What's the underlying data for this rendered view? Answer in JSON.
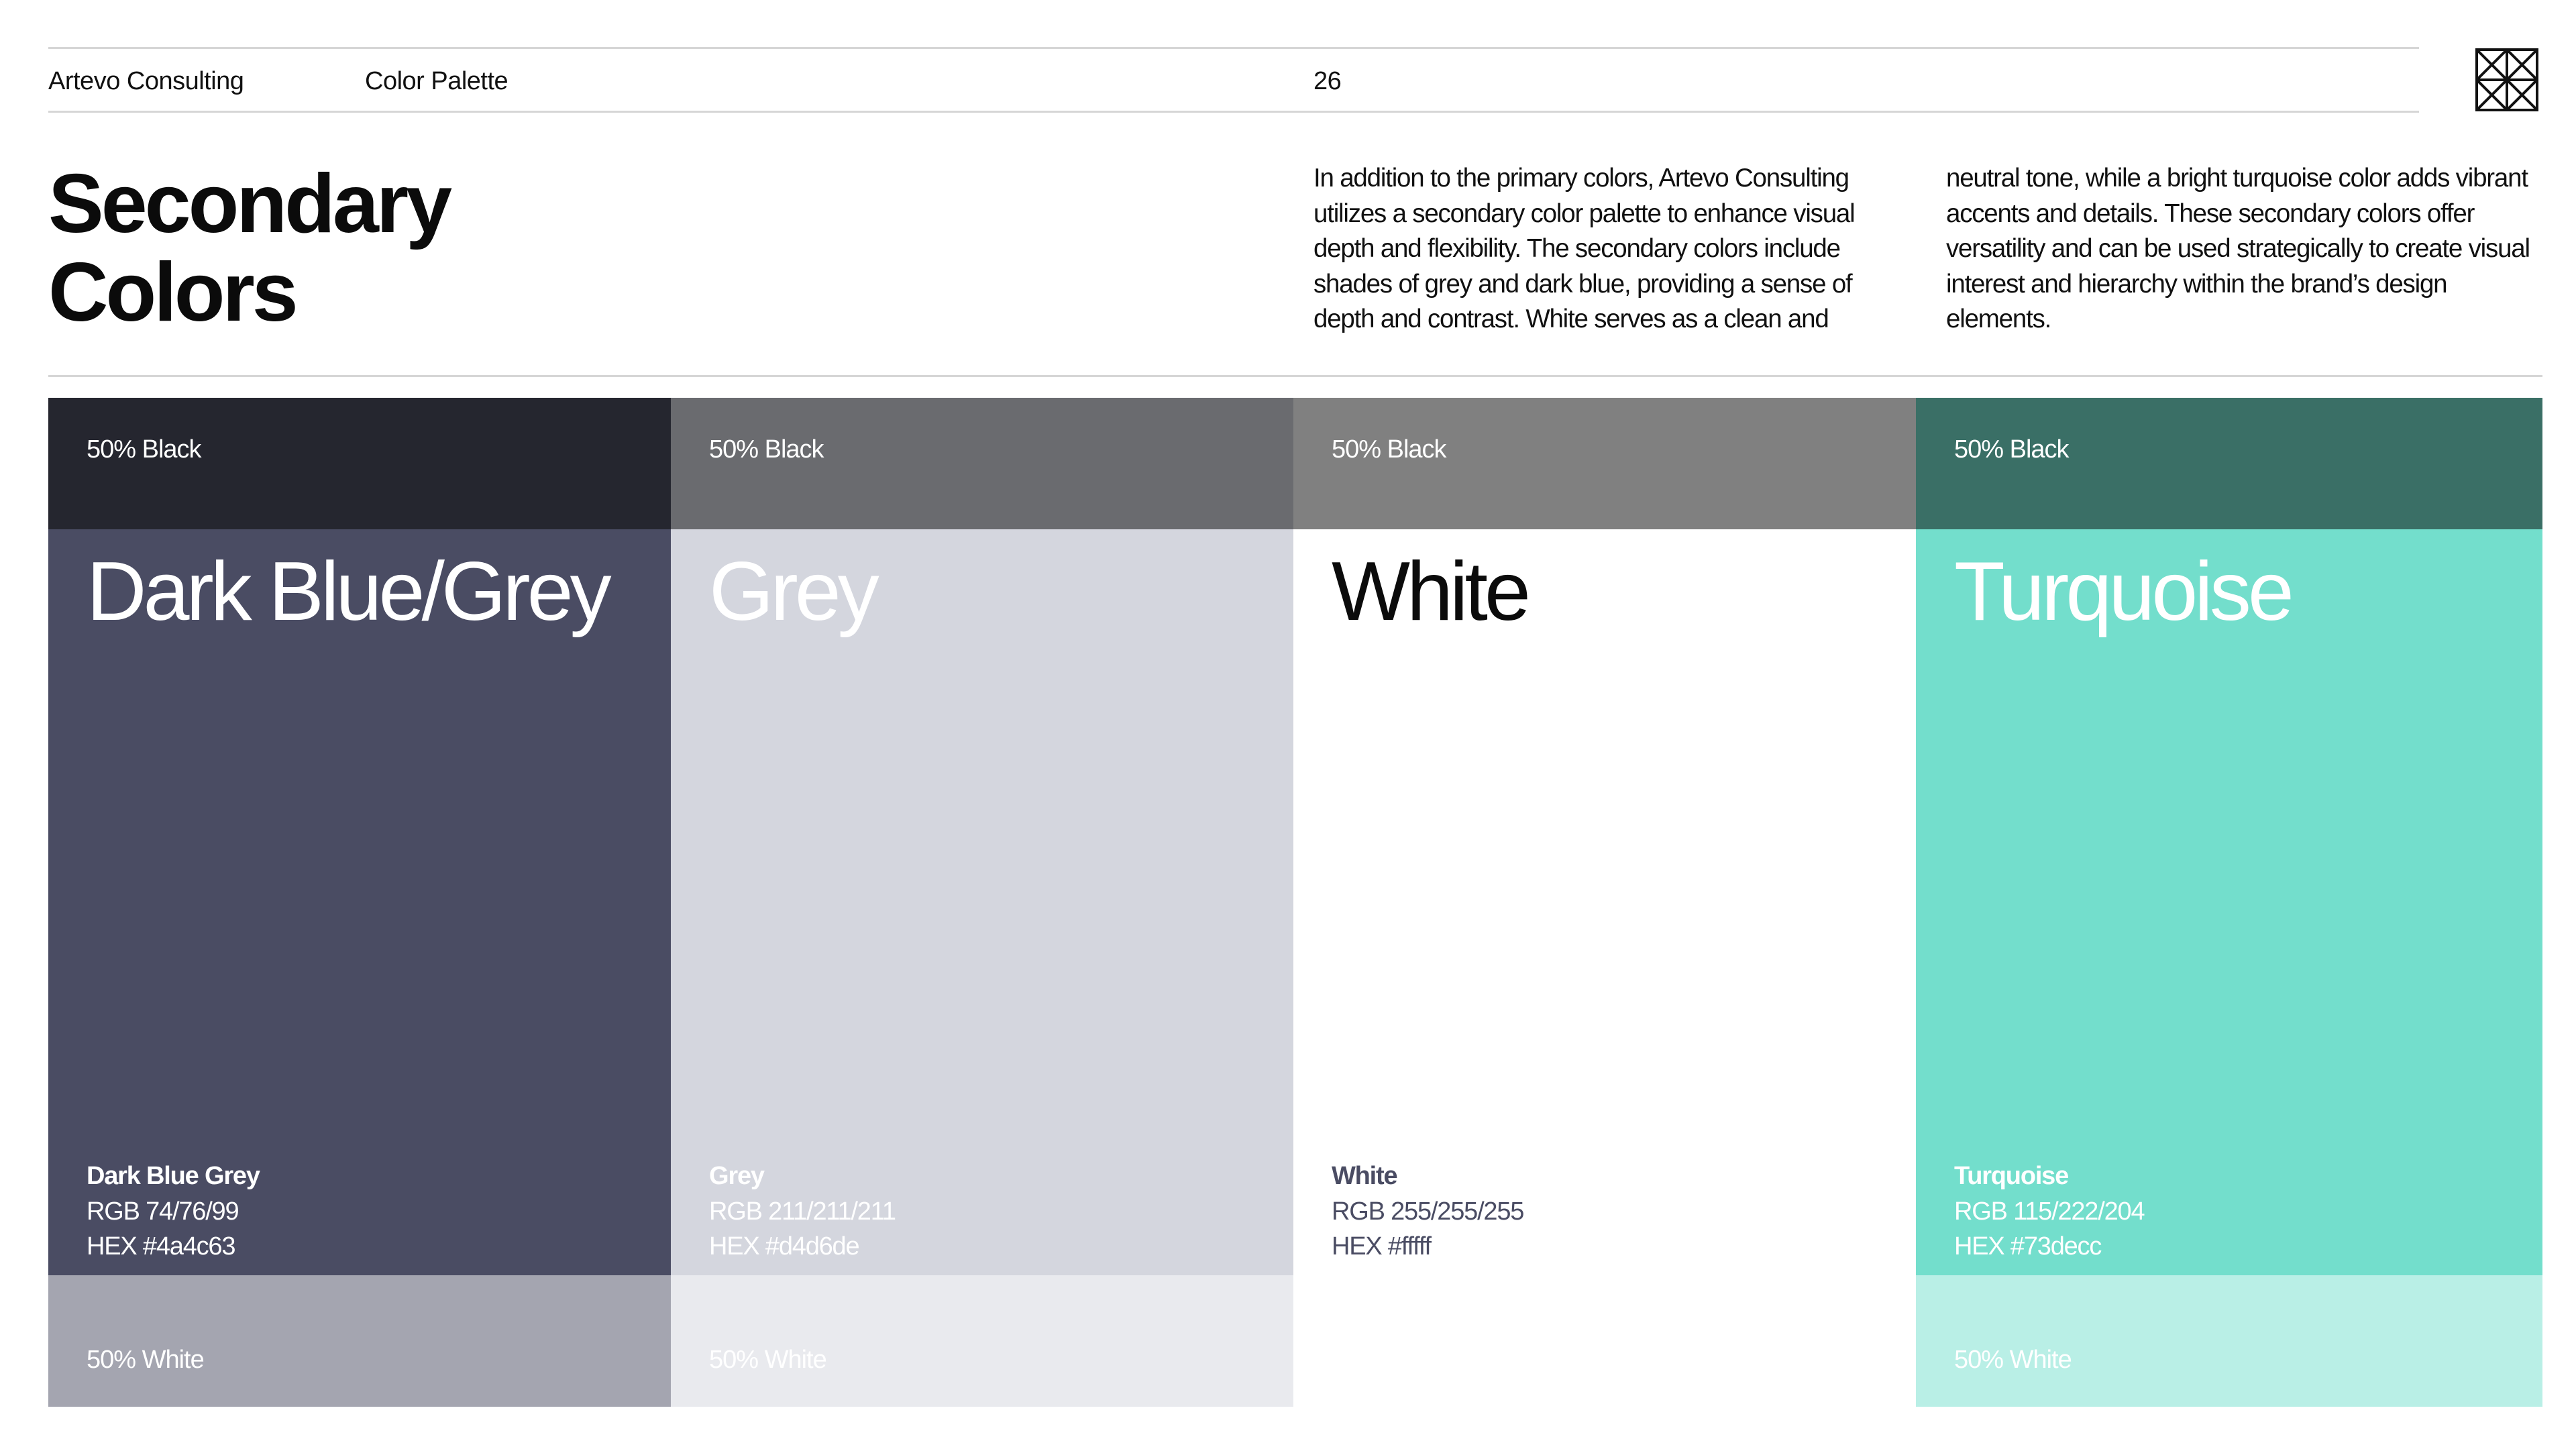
{
  "header": {
    "brand": "Artevo Consulting",
    "section": "Color Palette",
    "page_number": "26",
    "logo_icon": "crossed-grid-logo-icon"
  },
  "title": {
    "line1": "Secondary",
    "line2": "Colors"
  },
  "intro": {
    "column1": "In addition to the primary colors, Artevo Consulting utilizes a secondary color palette to enhance visual depth and flexibility. The secondary colors include shades of grey and dark blue, providing a sense of depth and contrast. White serves as a clean and",
    "column2": "neutral tone, while a bright turquoise color adds vibrant accents and details. These secondary colors offer versatility and can be used strategically to create visual interest and hierarchy within the brand’s design elements."
  },
  "swatches": [
    {
      "top_label": "50% Black",
      "name": "Dark Blue/Grey",
      "spec_name": "Dark Blue Grey",
      "rgb": "RGB 74/76/99",
      "hex_label": "HEX #4a4c63",
      "bottom_label": "50% White",
      "colors": {
        "top": "#25262f",
        "main": "#4a4c63",
        "bottom": "#a4a5b0",
        "name_text": "#ffffff",
        "spec_text": "#ffffff",
        "top_text": "#ffffff",
        "bottom_text": "#ffffff"
      }
    },
    {
      "top_label": "50% Black",
      "name": "Grey",
      "spec_name": "Grey",
      "rgb": "RGB 211/211/211",
      "hex_label": "HEX #d4d6de",
      "bottom_label": "50% White",
      "colors": {
        "top": "#6a6b6f",
        "main": "#d4d6de",
        "bottom": "#e9eaee",
        "name_text": "#ffffff",
        "spec_text": "#ffffff",
        "top_text": "#ffffff",
        "bottom_text": "#ffffff"
      }
    },
    {
      "top_label": "50% Black",
      "name": "White",
      "spec_name": "White",
      "rgb": "RGB 255/255/255",
      "hex_label": "HEX #fffff",
      "bottom_label": "",
      "colors": {
        "top": "#808080",
        "main": "#ffffff",
        "bottom": "#ffffff",
        "name_text": "#0b0b0b",
        "spec_text": "#4a4c63",
        "top_text": "#ffffff",
        "bottom_text": "#ffffff"
      }
    },
    {
      "top_label": "50% Black",
      "name": "Turquoise",
      "spec_name": "Turquoise",
      "rgb": "RGB 115/222/204",
      "hex_label": "HEX #73decc",
      "bottom_label": "50% White",
      "colors": {
        "top": "#3a6f66",
        "main": "#73decc",
        "bottom": "#b9efe6",
        "name_text": "#ffffff",
        "spec_text": "#ffffff",
        "top_text": "#ffffff",
        "bottom_text": "#ffffff"
      }
    }
  ]
}
